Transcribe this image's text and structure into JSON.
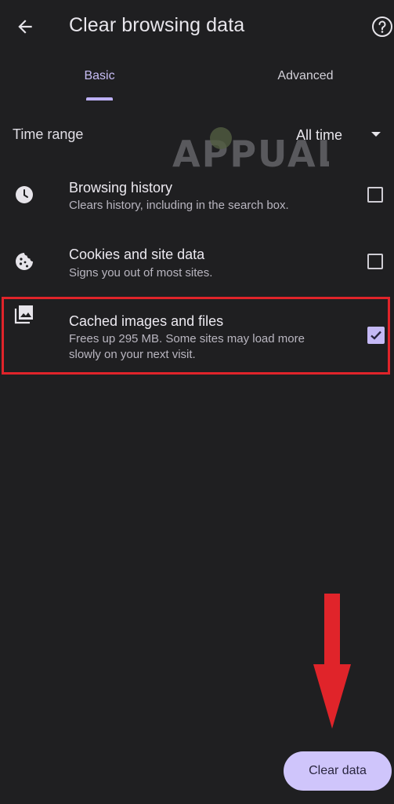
{
  "app_bar": {
    "title": "Clear browsing data",
    "back_icon": "arrow-left-icon",
    "help_icon": "help-circle-icon"
  },
  "tabs": [
    {
      "label": "Basic",
      "selected": true
    },
    {
      "label": "Advanced",
      "selected": false
    }
  ],
  "time_range": {
    "label": "Time range",
    "value": "All time"
  },
  "items": [
    {
      "icon": "clock-icon",
      "title": "Browsing history",
      "subtitle": "Clears history, including in the search box.",
      "checked": false
    },
    {
      "icon": "cookie-icon",
      "title": "Cookies and site data",
      "subtitle": "Signs you out of most sites.",
      "checked": false
    },
    {
      "icon": "image-gallery-icon",
      "title": "Cached images and files",
      "subtitle": "Frees up 295 MB. Some sites may load more slowly on your next visit.",
      "checked": true
    }
  ],
  "clear_button": {
    "label": "Clear data"
  },
  "colors": {
    "background": "#1f1f21",
    "accent": "#c5b9f6",
    "button_bg": "#cfc5fb",
    "annotation_red": "#e0242a"
  },
  "watermark": {
    "text": "APPUALS"
  }
}
